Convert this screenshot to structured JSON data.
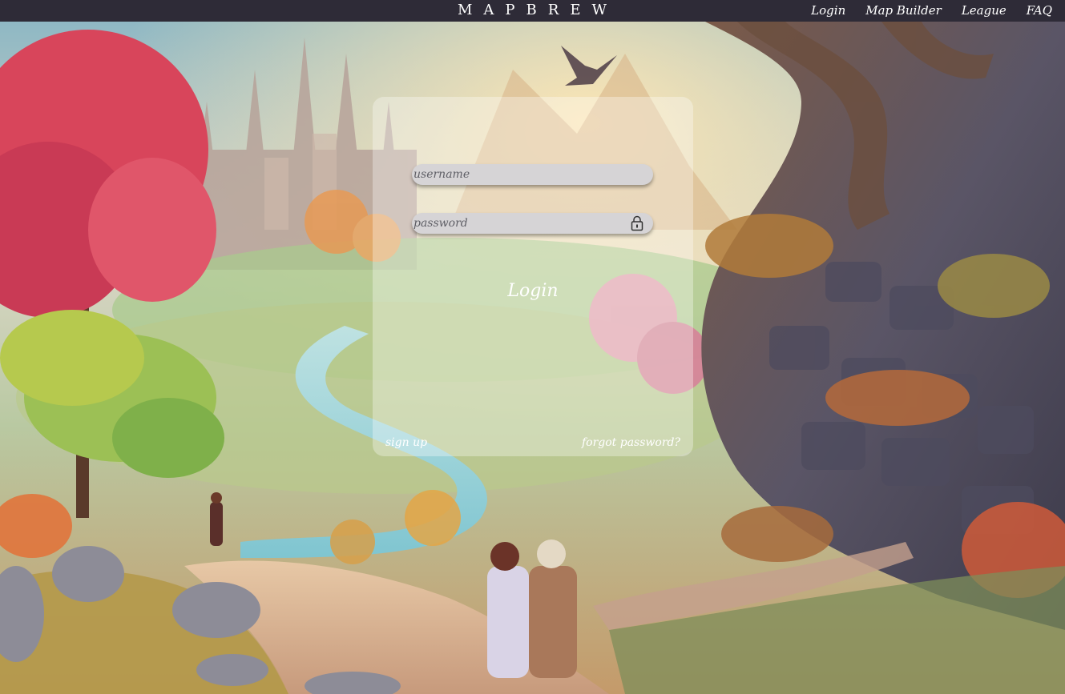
{
  "header": {
    "brand": "MAPBREW",
    "nav": [
      {
        "label": "Login"
      },
      {
        "label": "Map Builder"
      },
      {
        "label": "League"
      },
      {
        "label": "FAQ"
      }
    ]
  },
  "login_form": {
    "username_placeholder": "username",
    "password_placeholder": "password",
    "submit_label": "Login",
    "signup_label": "sign up",
    "forgot_label": "forgot password?"
  },
  "icons": {
    "password_field": "lock-icon",
    "background": "fantasy-landscape-painting"
  },
  "colors": {
    "topbar": "#2e2b37",
    "field_bg": "#d6d4d6",
    "card_overlay": "rgba(255,255,255,0.32)",
    "text_light": "#ffffff"
  }
}
